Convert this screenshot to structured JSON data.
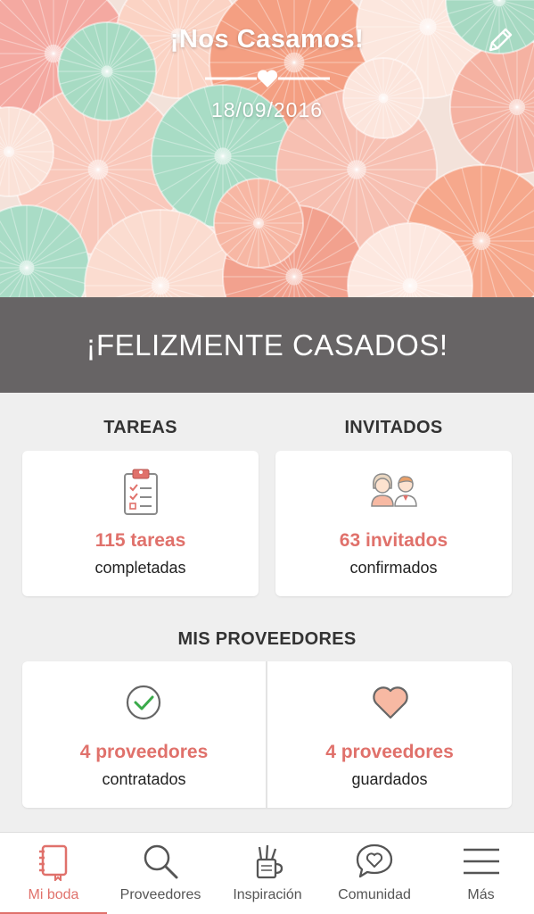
{
  "hero": {
    "title": "¡Nos Casamos!",
    "date": "18/09/2016"
  },
  "banner": {
    "text": "¡FELIZMENTE CASADOS!"
  },
  "tasks": {
    "heading": "TAREAS",
    "count": "115 tareas",
    "status": "completadas",
    "icon": "clipboard-icon"
  },
  "guests": {
    "heading": "INVITADOS",
    "count": "63 invitados",
    "status": "confirmados",
    "icon": "couple-icon"
  },
  "vendors": {
    "heading": "MIS PROVEEDORES",
    "hired": {
      "count": "4 proveedores",
      "status": "contratados",
      "icon": "check-circle-icon"
    },
    "saved": {
      "count": "4 proveedores",
      "status": "guardados",
      "icon": "heart-icon"
    }
  },
  "nav": {
    "items": [
      {
        "label": "Mi boda",
        "icon": "notebook-icon",
        "active": true
      },
      {
        "label": "Proveedores",
        "icon": "search-icon",
        "active": false
      },
      {
        "label": "Inspiración",
        "icon": "pencil-cup-icon",
        "active": false
      },
      {
        "label": "Comunidad",
        "icon": "chat-heart-icon",
        "active": false
      },
      {
        "label": "Más",
        "icon": "hamburger-menu-icon",
        "active": false
      }
    ]
  },
  "colors": {
    "accent": "#e0716b",
    "banner": "#676465",
    "background": "#efefef",
    "check": "#3aaa4a",
    "heart_fill": "#f7b9a3"
  }
}
